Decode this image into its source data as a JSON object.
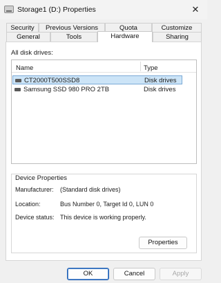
{
  "window": {
    "title": "Storage1 (D:) Properties",
    "close_glyph": "✕",
    "icon": "drive-icon"
  },
  "tabs_row1": [
    {
      "label": "Security"
    },
    {
      "label": "Previous Versions"
    },
    {
      "label": "Quota"
    },
    {
      "label": "Customize"
    }
  ],
  "tabs_row2": [
    {
      "label": "General"
    },
    {
      "label": "Tools"
    },
    {
      "label": "Hardware",
      "selected": true
    },
    {
      "label": "Sharing"
    }
  ],
  "hardware": {
    "all_disks_label": "All disk drives:",
    "columns": {
      "name": "Name",
      "type": "Type"
    },
    "drives": [
      {
        "name": "CT2000T500SSD8",
        "type": "Disk drives",
        "selected": true
      },
      {
        "name": "Samsung SSD 980 PRO 2TB",
        "type": "Disk drives",
        "selected": false
      }
    ],
    "device_properties": {
      "title": "Device Properties",
      "manufacturer_label": "Manufacturer:",
      "manufacturer_value": "(Standard disk drives)",
      "location_label": "Location:",
      "location_value": "Bus Number 0, Target Id 0, LUN 0",
      "status_label": "Device status:",
      "status_value": "This device is working properly.",
      "properties_button": "Properties"
    }
  },
  "footer": {
    "ok": "OK",
    "cancel": "Cancel",
    "apply": "Apply"
  }
}
